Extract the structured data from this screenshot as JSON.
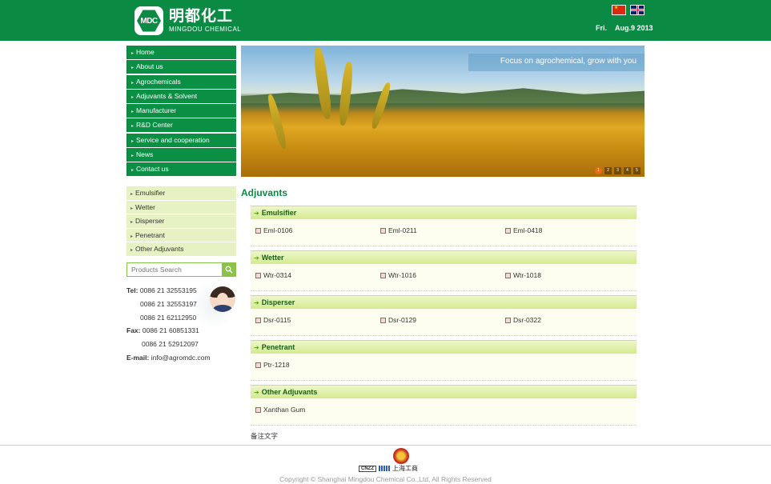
{
  "header": {
    "logo_mark": "MDC",
    "logo_cn": "明都化工",
    "logo_en": "MINGDOU CHEMICAL",
    "weekday": "Fri.",
    "date": "Aug.9 2013",
    "flags": [
      "china-flag-icon",
      "uk-flag-icon"
    ]
  },
  "nav": {
    "items": [
      {
        "label": "Home"
      },
      {
        "label": "About us"
      },
      {
        "label": "Agrochemicals"
      },
      {
        "label": "Adjuvants & Solvent"
      },
      {
        "label": "Manufacturer"
      },
      {
        "label": "R&D Center"
      },
      {
        "label": "Service and cooperation"
      },
      {
        "label": "News"
      },
      {
        "label": "Contact us"
      }
    ]
  },
  "subnav": {
    "items": [
      {
        "label": "Emulsifier"
      },
      {
        "label": "Wetter"
      },
      {
        "label": "Disperser"
      },
      {
        "label": "Penetrant"
      },
      {
        "label": "Other Adjuvants"
      }
    ]
  },
  "search": {
    "placeholder": "Products Search",
    "icon": "search-icon"
  },
  "contact": {
    "tel_label": "Tel:",
    "tel": [
      "0086 21 32553195",
      "0086 21 32553197",
      "0086 21 62112950"
    ],
    "fax_label": "Fax:",
    "fax": [
      "0086 21 60851331",
      "0086 21 52912097"
    ],
    "email_label": "E-mail:",
    "email": "info@agromdc.com"
  },
  "banner": {
    "caption": "Focus on agrochemical, grow with you",
    "slides": [
      "1",
      "2",
      "3",
      "4",
      "5"
    ],
    "active_slide": 1
  },
  "main": {
    "title": "Adjuvants",
    "sections": [
      {
        "title": "Emulsifier",
        "products": [
          "Eml-0106",
          "Eml-0211",
          "Eml-0418"
        ]
      },
      {
        "title": "Wetter",
        "products": [
          "Wtr-0314",
          "Wtr-1016",
          "Wtr-1018"
        ]
      },
      {
        "title": "Disperser",
        "products": [
          "Dsr-0115",
          "Dsr-0129",
          "Dsr-0322"
        ]
      },
      {
        "title": "Penetrant",
        "products": [
          "Ptr-1218"
        ]
      },
      {
        "title": "Other Adjuvants",
        "products": [
          "Xanthan Gum"
        ]
      }
    ],
    "note": "备注文字"
  },
  "footer": {
    "badge_cnzz": "CNZZ",
    "badge_sh": "上海工商",
    "copyright": "Copyright © Shanghai Mingdou Chemical Co.,Ltd, All Rights Reserved"
  },
  "colors": {
    "brand_green": "#0b8a44",
    "subnav_bg": "#e6f2c4",
    "section_head": "#d4ea8f",
    "slide_active": "#ea6a1b"
  }
}
